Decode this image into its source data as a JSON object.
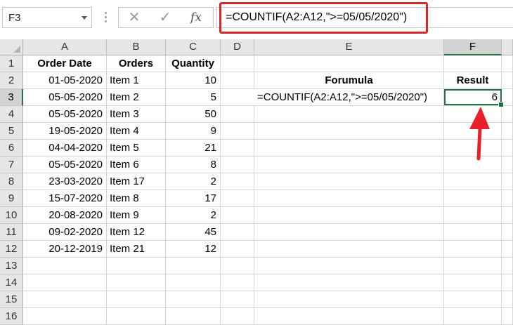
{
  "namebox": {
    "value": "F3"
  },
  "formula_bar": {
    "cancel_icon": "✕",
    "enter_icon": "✓",
    "fx_label": "fx",
    "formula": "=COUNTIF(A2:A12,\">=05/05/2020\")"
  },
  "columns": [
    "A",
    "B",
    "C",
    "D",
    "E",
    "F"
  ],
  "rows": [
    "1",
    "2",
    "3",
    "4",
    "5",
    "6",
    "7",
    "8",
    "9",
    "10",
    "11",
    "12",
    "13",
    "14",
    "15",
    "16"
  ],
  "headers": {
    "order_date": "Order Date",
    "orders": "Orders",
    "quantity": "Quantity"
  },
  "data_rows": [
    {
      "date": "01-05-2020",
      "item": "Item 1",
      "qty": "10"
    },
    {
      "date": "05-05-2020",
      "item": "Item 2",
      "qty": "5"
    },
    {
      "date": "05-05-2020",
      "item": "Item 3",
      "qty": "50"
    },
    {
      "date": "19-05-2020",
      "item": "Item 4",
      "qty": "9"
    },
    {
      "date": "04-04-2020",
      "item": "Item 5",
      "qty": "21"
    },
    {
      "date": "05-05-2020",
      "item": "Item 6",
      "qty": "8"
    },
    {
      "date": "23-03-2020",
      "item": "Item 17",
      "qty": "2"
    },
    {
      "date": "15-07-2020",
      "item": "Item 8",
      "qty": "17"
    },
    {
      "date": "20-08-2020",
      "item": "Item 9",
      "qty": "2"
    },
    {
      "date": "09-02-2020",
      "item": "Item 12",
      "qty": "45"
    },
    {
      "date": "20-12-2019",
      "item": "Item 21",
      "qty": "12"
    }
  ],
  "side_table": {
    "formula_header": "Forumula",
    "result_header": "Result",
    "formula_text": "=COUNTIF(A2:A12,\">=05/05/2020\")",
    "result_value": "6"
  },
  "colors": {
    "highlight_box": "#d8262c",
    "arrow": "#e8202a",
    "selection": "#217346"
  }
}
